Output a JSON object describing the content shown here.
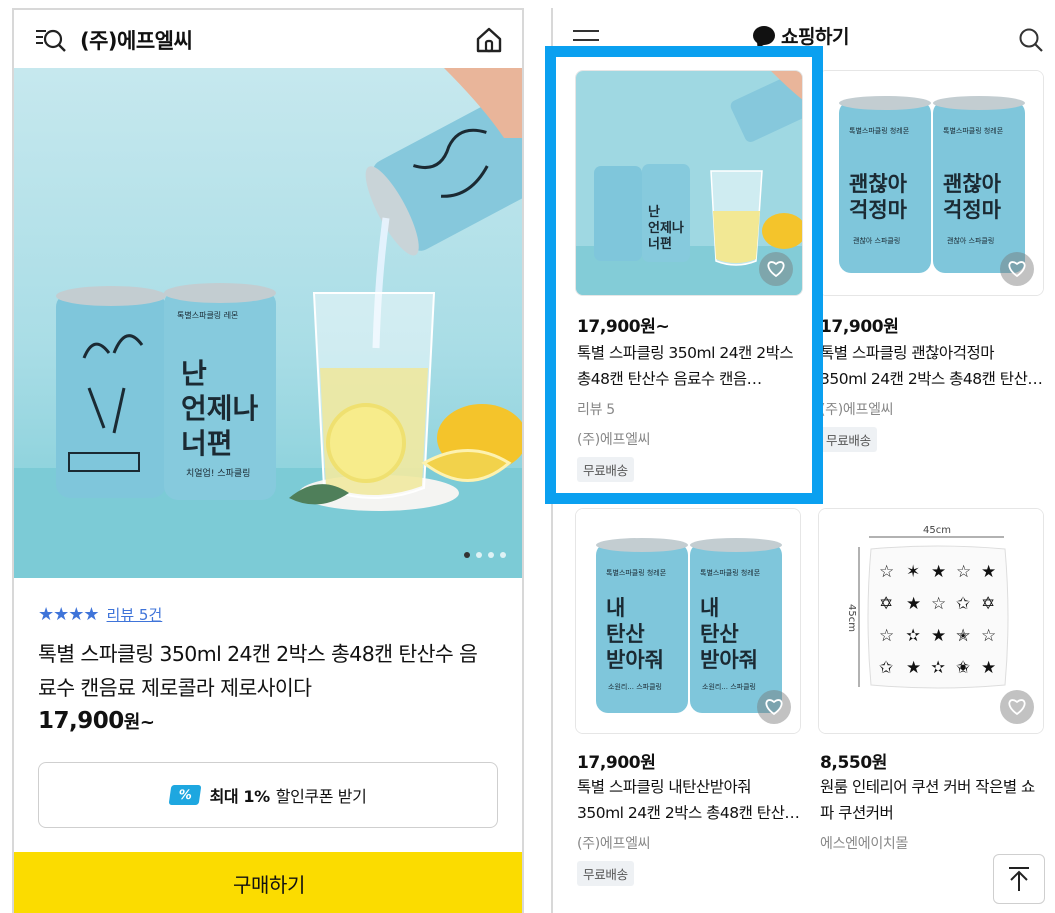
{
  "left": {
    "store_name": "(주)에프엘씨",
    "stars_text": "★★★★",
    "review_link": "리뷰 5건",
    "title": "톡별 스파클링 350ml 24캔 2박스 총48캔 탄산수 음료수 캔음료 제로콜라 제로사이다",
    "price_value": "17,900",
    "price_suffix": "원~",
    "coupon": {
      "icon": "%",
      "bold": "최대 1%",
      "text": "할인쿠폰 받기"
    },
    "buy_label": "구매하기",
    "gallery": {
      "current": 1,
      "total": 4
    },
    "can_label_lines": [
      "난",
      "언제나",
      "너편"
    ],
    "can_brand": "톡별스파클링 레몬",
    "can_small": "치얼업! 스파클링"
  },
  "right": {
    "brand": "쇼핑하기",
    "cards": [
      {
        "price": "17,900원~",
        "name": "톡별 스파클링 350ml 24캔 2박스 총48캔 탄산수 음료수 캔음…",
        "review": "리뷰 5",
        "seller": "(주)에프엘씨",
        "badge": "무료배송",
        "can_lines": [
          "난",
          "언제나",
          "너편"
        ]
      },
      {
        "price": "17,900원",
        "name": "톡별 스파클링 괜찮아걱정마 350ml 24캔 2박스 총48캔 탄산…",
        "seller": "(주)에프엘씨",
        "badge": "무료배송",
        "can_lines": [
          "괜찮아",
          "걱정마"
        ],
        "can_brand": "톡별스파클링 청레몬",
        "can_small": "괜찮아 스파클링"
      },
      {
        "price": "17,900원",
        "name": "톡별 스파클링 내탄산받아줘 350ml 24캔 2박스 총48캔 탄산…",
        "seller": "(주)에프엘씨",
        "badge": "무료배송",
        "can_lines": [
          "내",
          "탄산",
          "받아줘"
        ],
        "can_brand": "톡별스파클링 청레몬",
        "can_small": "소원리... 스파클링"
      },
      {
        "price": "8,550원",
        "name": "원룸 인테리어 쿠션 커버 작은별 쇼파 쿠션커버",
        "seller": "에스엔에이치몰",
        "dim_w": "45cm",
        "dim_h": "45cm"
      }
    ]
  },
  "colors": {
    "accent_yellow": "#fbdc00",
    "highlight_blue": "#0aa0f0",
    "star_blue": "#3f74d9",
    "can_blue": "#7fc6db"
  }
}
